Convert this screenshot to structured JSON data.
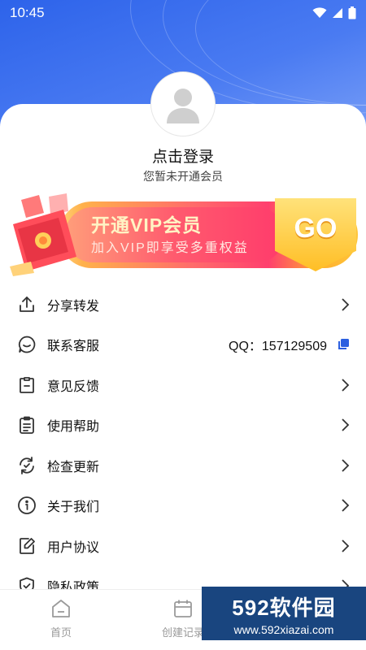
{
  "status_bar": {
    "time": "10:45"
  },
  "profile": {
    "login_title": "点击登录",
    "member_status": "您暂未开通会员"
  },
  "vip_banner": {
    "title": "开通VIP会员",
    "subtitle": "加入VIP即享受多重权益",
    "go_label": "GO"
  },
  "menu": {
    "items": [
      {
        "label": "分享转发",
        "icon": "share-icon"
      },
      {
        "label": "联系客服",
        "icon": "chat-icon",
        "value": "QQ：157129509"
      },
      {
        "label": "意见反馈",
        "icon": "feedback-icon"
      },
      {
        "label": "使用帮助",
        "icon": "clipboard-icon"
      },
      {
        "label": "检查更新",
        "icon": "refresh-icon"
      },
      {
        "label": "关于我们",
        "icon": "info-icon"
      },
      {
        "label": "用户协议",
        "icon": "edit-document-icon"
      },
      {
        "label": "隐私政策",
        "icon": "shield-icon"
      }
    ]
  },
  "tab_bar": {
    "tabs": [
      {
        "label": "首页",
        "icon": "home-icon"
      },
      {
        "label": "创建记录",
        "icon": "calendar-icon"
      }
    ]
  },
  "watermark": {
    "brand": "592软件园",
    "url": "www.592xiazai.com"
  },
  "colors": {
    "header_blue": "#2d63ea",
    "copy_icon": "#2b5fe0",
    "vip_pink": "#ff3f6e",
    "vip_gold": "#ffbe25"
  }
}
